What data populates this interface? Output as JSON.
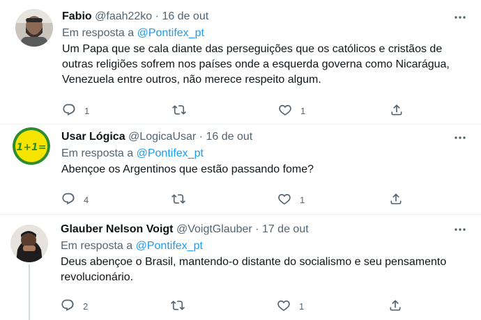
{
  "tweets": [
    {
      "name": "Fabio",
      "handle": "@faah22ko",
      "date": "16 de out",
      "reply_prefix": "Em resposta a",
      "reply_to": "@Pontifex_pt",
      "text": "Um Papa que se cala diante das perseguições que os católicos e cristãos de outras religiões sofrem nos países onde a esquerda governa como Nicarágua, Venezuela entre outros, não merece respeito algum.",
      "replies": "1",
      "retweets": "",
      "likes": "1"
    },
    {
      "name": "Usar Lógica",
      "handle": "@LogicaUsar",
      "date": "16 de out",
      "reply_prefix": "Em resposta a",
      "reply_to": "@Pontifex_pt",
      "text": "Abençoe os Argentinos que estão passando fome?",
      "replies": "4",
      "retweets": "",
      "likes": "1",
      "avatar_text": "1+1="
    },
    {
      "name": "Glauber Nelson Voigt",
      "handle": "@VoigtGlauber",
      "date": "17 de out",
      "reply_prefix": "Em resposta a",
      "reply_to": "@Pontifex_pt",
      "text": "Deus abençoe o Brasil, mantendo-o distante do socialismo e seu pensamento revolucionário.",
      "replies": "2",
      "retweets": "",
      "likes": "1"
    }
  ],
  "separator": "·",
  "icons": [
    "more-icon",
    "reply-icon",
    "retweet-icon",
    "like-icon",
    "share-icon"
  ],
  "colors": {
    "link": "#1d9bf0",
    "muted": "#536471",
    "text": "#0f1419"
  }
}
